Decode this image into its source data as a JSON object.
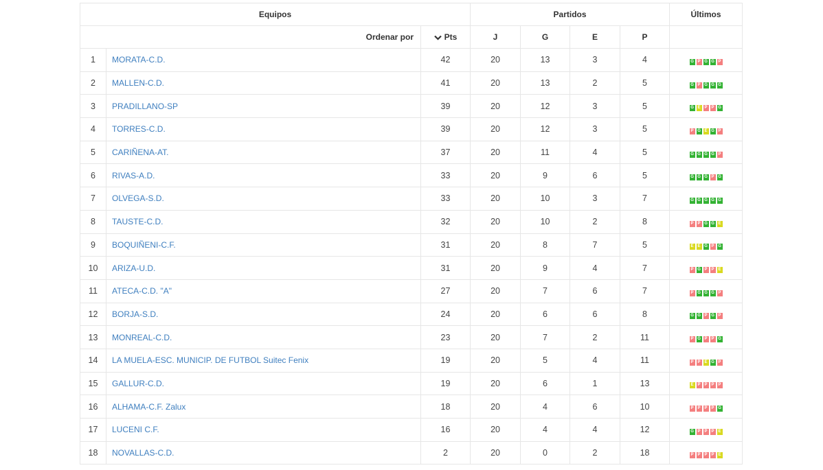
{
  "headers": {
    "equipos": "Equipos",
    "partidos": "Partidos",
    "ultimos": "Últimos"
  },
  "subheaders": {
    "ordenar_por": "Ordenar por",
    "pts": "Pts",
    "j": "J",
    "g": "G",
    "e": "E",
    "p": "P"
  },
  "colors": {
    "win": "#33b233",
    "loss": "#f47f7f",
    "draw": "#d9d920",
    "link": "#3f7fbf"
  },
  "rows": [
    {
      "pos": "1",
      "team": "MORATA-C.D.",
      "pts": "42",
      "j": "20",
      "g": "13",
      "e": "3",
      "p": "4",
      "form": [
        "G",
        "P",
        "G",
        "G",
        "P"
      ]
    },
    {
      "pos": "2",
      "team": "MALLEN-C.D.",
      "pts": "41",
      "j": "20",
      "g": "13",
      "e": "2",
      "p": "5",
      "form": [
        "G",
        "P",
        "G",
        "G",
        "G"
      ]
    },
    {
      "pos": "3",
      "team": "PRADILLANO-SP",
      "pts": "39",
      "j": "20",
      "g": "12",
      "e": "3",
      "p": "5",
      "form": [
        "G",
        "E",
        "P",
        "P",
        "G"
      ]
    },
    {
      "pos": "4",
      "team": "TORRES-C.D.",
      "pts": "39",
      "j": "20",
      "g": "12",
      "e": "3",
      "p": "5",
      "form": [
        "P",
        "G",
        "E",
        "G",
        "P"
      ]
    },
    {
      "pos": "5",
      "team": "CARIÑENA-AT.",
      "pts": "37",
      "j": "20",
      "g": "11",
      "e": "4",
      "p": "5",
      "form": [
        "G",
        "G",
        "G",
        "G",
        "P"
      ]
    },
    {
      "pos": "6",
      "team": "RIVAS-A.D.",
      "pts": "33",
      "j": "20",
      "g": "9",
      "e": "6",
      "p": "5",
      "form": [
        "G",
        "G",
        "G",
        "P",
        "G"
      ]
    },
    {
      "pos": "7",
      "team": "OLVEGA-S.D.",
      "pts": "33",
      "j": "20",
      "g": "10",
      "e": "3",
      "p": "7",
      "form": [
        "G",
        "G",
        "G",
        "G",
        "G"
      ]
    },
    {
      "pos": "8",
      "team": "TAUSTE-C.D.",
      "pts": "32",
      "j": "20",
      "g": "10",
      "e": "2",
      "p": "8",
      "form": [
        "P",
        "P",
        "G",
        "G",
        "E"
      ]
    },
    {
      "pos": "9",
      "team": "BOQUIÑENI-C.F.",
      "pts": "31",
      "j": "20",
      "g": "8",
      "e": "7",
      "p": "5",
      "form": [
        "E",
        "E",
        "G",
        "P",
        "G"
      ]
    },
    {
      "pos": "10",
      "team": "ARIZA-U.D.",
      "pts": "31",
      "j": "20",
      "g": "9",
      "e": "4",
      "p": "7",
      "form": [
        "P",
        "G",
        "P",
        "P",
        "E"
      ]
    },
    {
      "pos": "11",
      "team": "ATECA-C.D. \"A\"",
      "pts": "27",
      "j": "20",
      "g": "7",
      "e": "6",
      "p": "7",
      "form": [
        "P",
        "G",
        "G",
        "G",
        "P"
      ]
    },
    {
      "pos": "12",
      "team": "BORJA-S.D.",
      "pts": "24",
      "j": "20",
      "g": "6",
      "e": "6",
      "p": "8",
      "form": [
        "G",
        "G",
        "P",
        "G",
        "P"
      ]
    },
    {
      "pos": "13",
      "team": "MONREAL-C.D.",
      "pts": "23",
      "j": "20",
      "g": "7",
      "e": "2",
      "p": "11",
      "form": [
        "P",
        "G",
        "P",
        "P",
        "G"
      ]
    },
    {
      "pos": "14",
      "team": "LA MUELA-ESC. MUNICIP. DE FUTBOL Suitec Fenix",
      "pts": "19",
      "j": "20",
      "g": "5",
      "e": "4",
      "p": "11",
      "form": [
        "P",
        "P",
        "E",
        "G",
        "P"
      ]
    },
    {
      "pos": "15",
      "team": "GALLUR-C.D.",
      "pts": "19",
      "j": "20",
      "g": "6",
      "e": "1",
      "p": "13",
      "form": [
        "E",
        "P",
        "P",
        "P",
        "P"
      ]
    },
    {
      "pos": "16",
      "team": "ALHAMA-C.F. Zalux",
      "pts": "18",
      "j": "20",
      "g": "4",
      "e": "6",
      "p": "10",
      "form": [
        "P",
        "P",
        "P",
        "P",
        "G"
      ]
    },
    {
      "pos": "17",
      "team": "LUCENI C.F.",
      "pts": "16",
      "j": "20",
      "g": "4",
      "e": "4",
      "p": "12",
      "form": [
        "G",
        "P",
        "P",
        "P",
        "E"
      ]
    },
    {
      "pos": "18",
      "team": "NOVALLAS-C.D.",
      "pts": "2",
      "j": "20",
      "g": "0",
      "e": "2",
      "p": "18",
      "form": [
        "P",
        "P",
        "P",
        "P",
        "E"
      ]
    }
  ]
}
